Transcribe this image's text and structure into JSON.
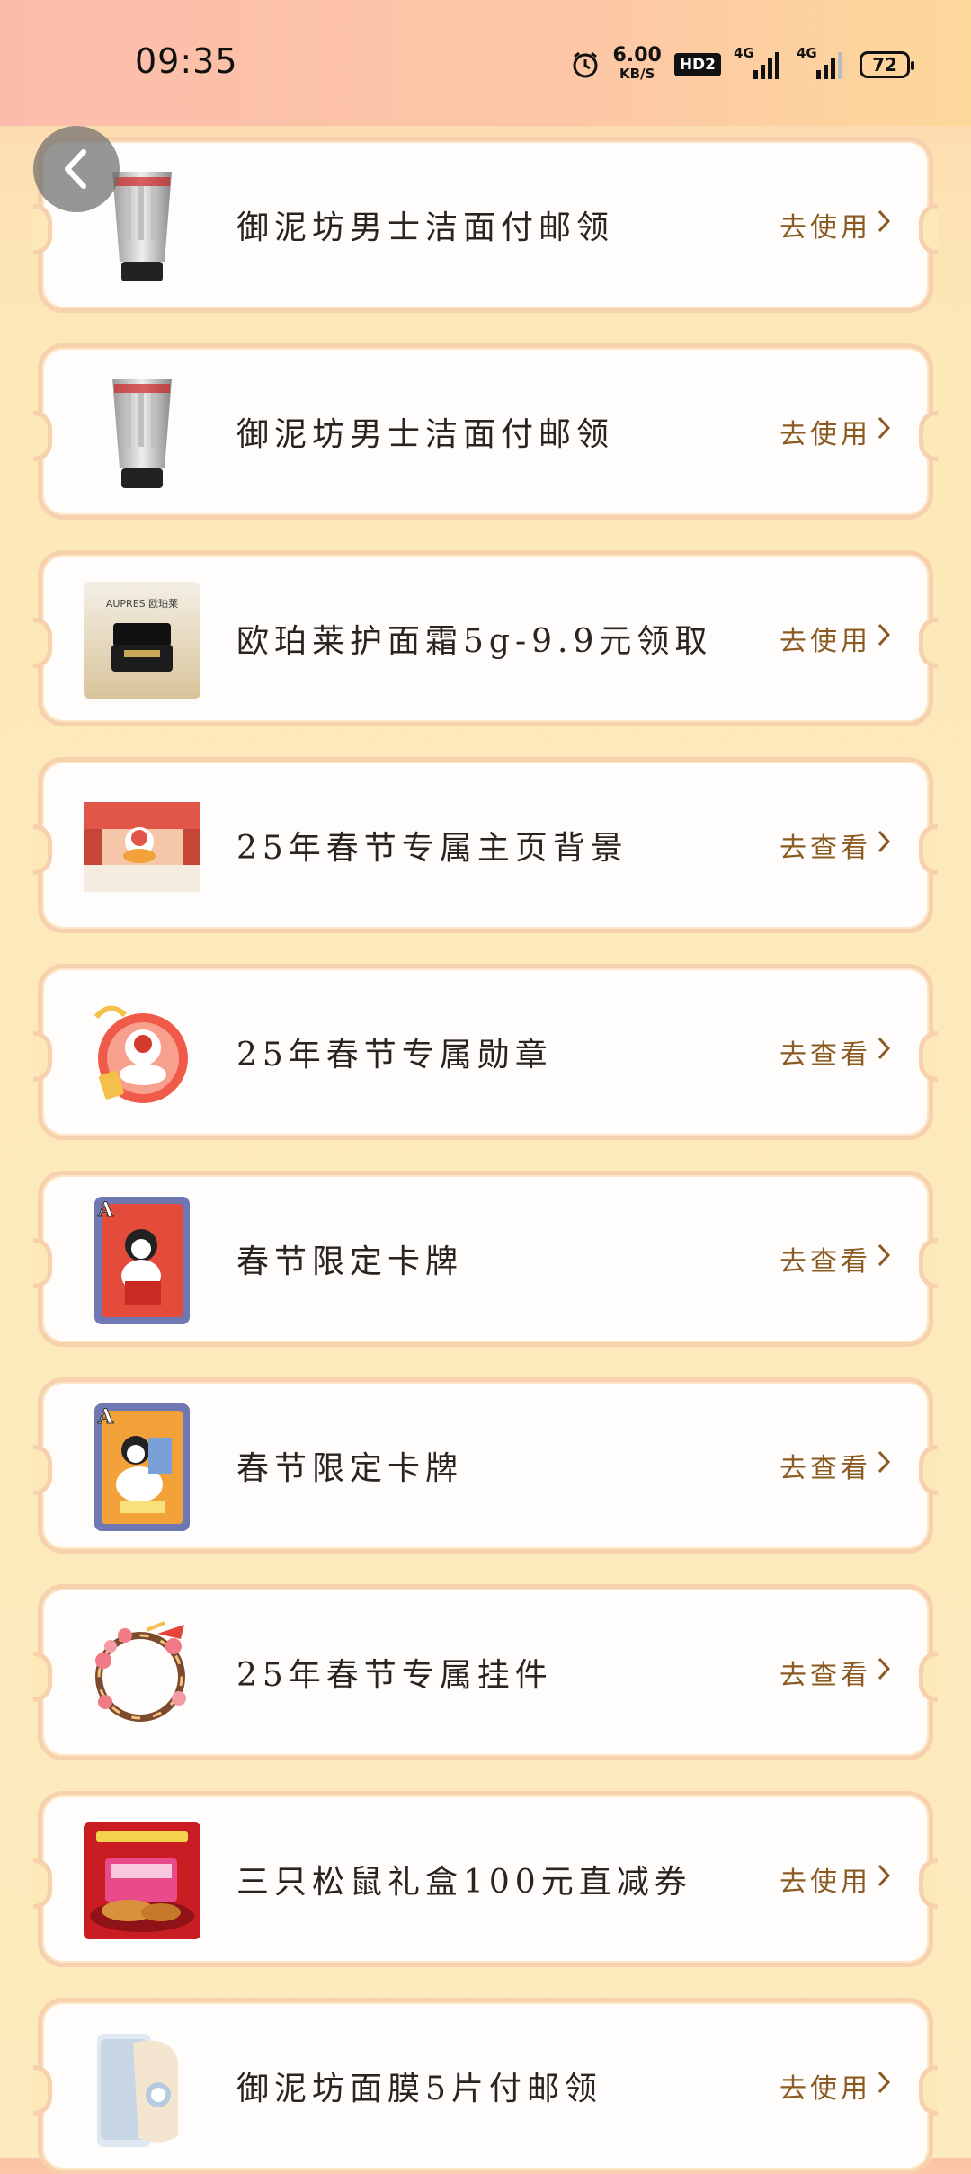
{
  "status_bar": {
    "time": "09:35",
    "net_speed_value": "6.00",
    "net_speed_unit": "KB/S",
    "hd_badge": "HD2",
    "signal1_label": "4G",
    "signal2_label": "4G",
    "battery": "72",
    "icons": [
      "alarm-icon",
      "signal-icon",
      "battery-icon"
    ]
  },
  "back_button": {
    "icon": "chevron-left-icon"
  },
  "items": [
    {
      "title": "御泥坊男士洁面付邮领",
      "action": "去使用",
      "thumb": "cleanser-tube-image"
    },
    {
      "title": "御泥坊男士洁面付邮领",
      "action": "去使用",
      "thumb": "cleanser-tube-image"
    },
    {
      "title": "欧珀莱护面霜5g-9.9元领取",
      "action": "去使用",
      "thumb": "cream-jar-image",
      "thumb_brand": "AUPRES 欧珀莱"
    },
    {
      "title": "25年春节专属主页背景",
      "action": "去查看",
      "thumb": "festival-background-image"
    },
    {
      "title": "25年春节专属勋章",
      "action": "去查看",
      "thumb": "festival-medal-image"
    },
    {
      "title": "春节限定卡牌",
      "action": "去查看",
      "thumb": "festival-card-image"
    },
    {
      "title": "春节限定卡牌",
      "action": "去查看",
      "thumb": "festival-card-image"
    },
    {
      "title": "25年春节专属挂件",
      "action": "去查看",
      "thumb": "festival-wreath-image"
    },
    {
      "title": "三只松鼠礼盒100元直减券",
      "action": "去使用",
      "thumb": "gift-box-image"
    },
    {
      "title": "御泥坊面膜5片付邮领",
      "action": "去使用",
      "thumb": "face-mask-image"
    }
  ],
  "colors": {
    "card_border": "#f7d0ad",
    "action_text": "#8a5a22",
    "background": "#fde8b8"
  }
}
